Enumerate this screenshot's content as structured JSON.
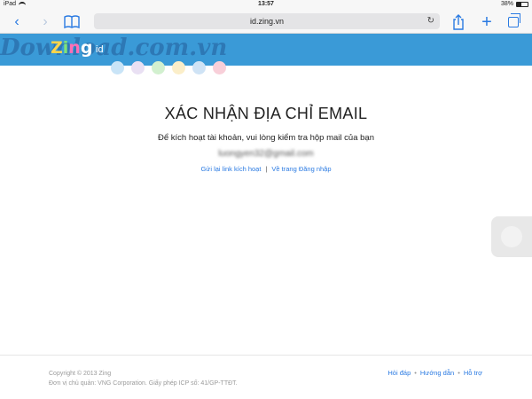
{
  "status_bar": {
    "carrier": "iPad",
    "time": "13:57",
    "battery": "38%",
    "battery_level": 0.38
  },
  "browser": {
    "url": "id.zing.vn"
  },
  "header": {
    "logo_letters": [
      "Z",
      "i",
      "n",
      "g"
    ],
    "logo_suffix": "id",
    "watermark": "Download.com.vn",
    "accent_color": "#3a9ad7"
  },
  "dots": [
    "#c9e4f7",
    "#e9e0f3",
    "#d2f0cf",
    "#fbeec9",
    "#cfe3f5",
    "#f8cfd9"
  ],
  "main": {
    "title": "XÁC NHẬN ĐỊA CHỈ EMAIL",
    "description": "Để kích hoạt tài khoản, vui lòng kiểm tra hộp mail của bạn",
    "email": "luongyen32@gmail.com",
    "resend_link": "Gửi lại link kích hoạt",
    "separator": "|",
    "login_link": "Về trang Đăng nhập"
  },
  "footer": {
    "copyright": "Copyright © 2013 Zing",
    "owner": "Đơn vị chủ quản: VNG Corporation. Giấy phép ICP số: 41/GP-TTĐT.",
    "links": [
      "Hỏi đáp",
      "Hướng dẫn",
      "Hỗ trợ"
    ],
    "separator": "•"
  }
}
